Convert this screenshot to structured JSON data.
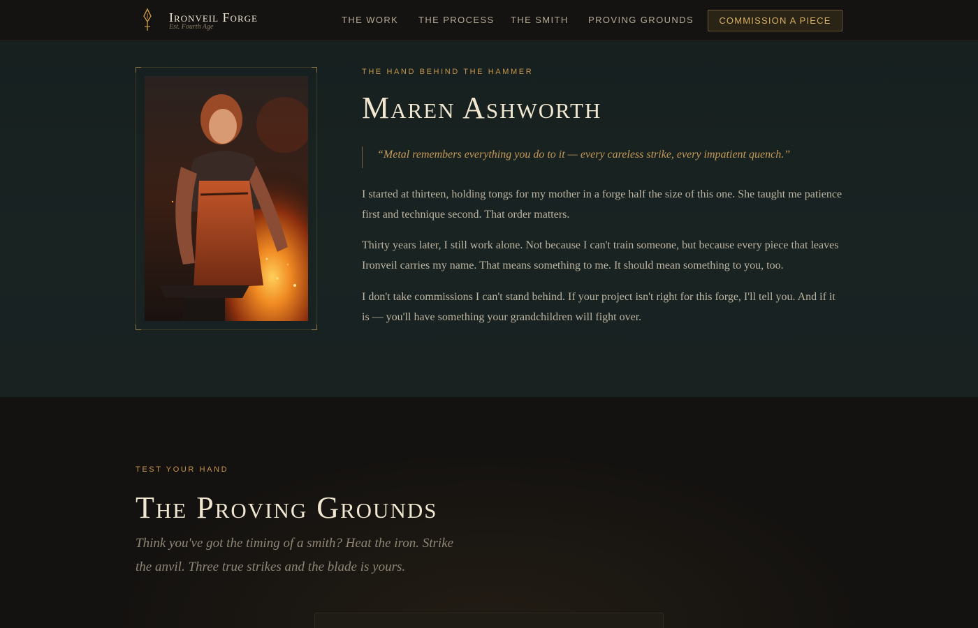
{
  "nav": {
    "brand_name": "Ironveil Forge",
    "brand_sub": "Est. Fourth Age",
    "brand_icon": "quill-anvil-icon",
    "links": [
      "THE WORK",
      "THE PROCESS",
      "THE SMITH",
      "PROVING GROUNDS"
    ],
    "cta": "COMMISSION A PIECE"
  },
  "smith": {
    "eyebrow": "THE HAND BEHIND THE HAMMER",
    "name": "Maren Ashworth",
    "quote": "“Metal remembers everything you do to it — every careless strike, every impatient quench.”",
    "paragraphs": [
      "I started at thirteen, holding tongs for my mother in a forge half the size of this one. She taught me patience first and technique second. That order matters.",
      "Thirty years later, I still work alone. Not because I can't train someone, but because every piece that leaves Ironveil carries my name. That means something to me. It should mean something to you, too.",
      "I don't take commissions I can't stand behind. If your project isn't right for this forge, I'll tell you. And if it is — you'll have something your grandchildren will fight over."
    ]
  },
  "proving": {
    "eyebrow": "TEST YOUR HAND",
    "title": "The Proving Grounds",
    "description": "Think you've got the timing of a smith? Heat the iron. Strike the anvil. Three true strikes and the blade is yours."
  },
  "colors": {
    "accent_gold": "#c9964a",
    "nav_bg": "#141311",
    "section_teal": "#182322",
    "page_bg": "#131210"
  }
}
